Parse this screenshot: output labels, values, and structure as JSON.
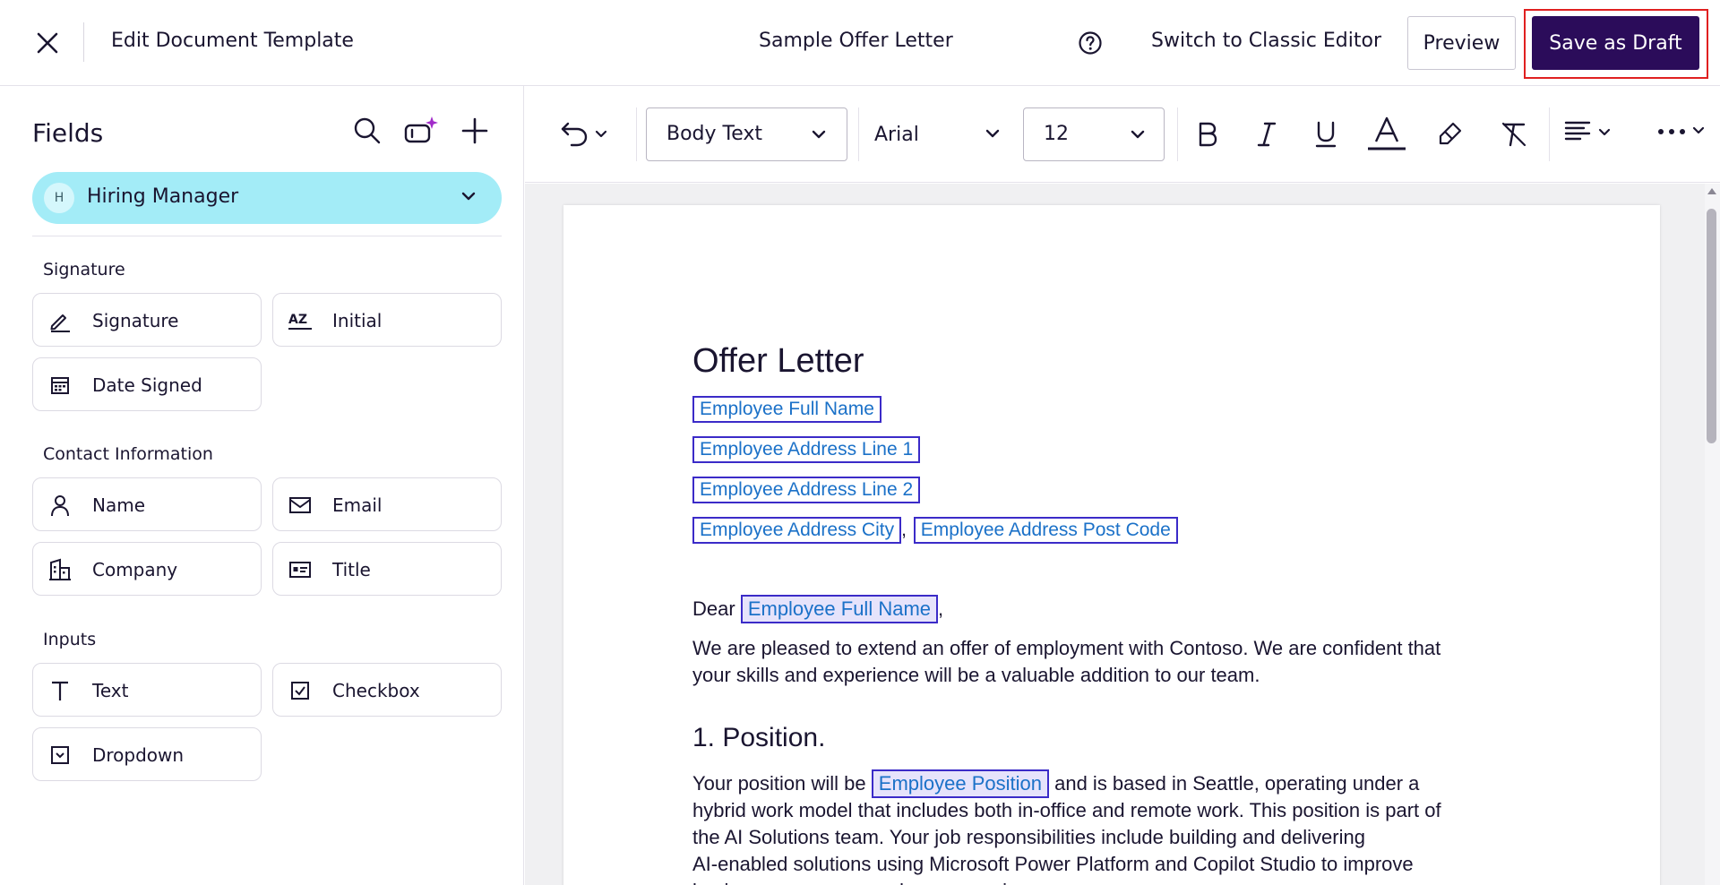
{
  "header": {
    "app_title": "Edit Document Template",
    "document_title": "Sample Offer Letter",
    "classic_editor_label": "Switch to Classic Editor",
    "preview_label": "Preview",
    "save_draft_label": "Save as Draft"
  },
  "sidebar": {
    "title": "Fields",
    "recipient": {
      "initial": "H",
      "name": "Hiring Manager"
    },
    "sections": [
      {
        "label": "Signature",
        "fields": [
          {
            "label": "Signature",
            "icon": "pen-icon"
          },
          {
            "label": "Initial",
            "icon": "initials-icon"
          },
          {
            "label": "Date Signed",
            "icon": "calendar-icon"
          }
        ]
      },
      {
        "label": "Contact Information",
        "fields": [
          {
            "label": "Name",
            "icon": "person-icon"
          },
          {
            "label": "Email",
            "icon": "envelope-icon"
          },
          {
            "label": "Company",
            "icon": "building-icon"
          },
          {
            "label": "Title",
            "icon": "id-card-icon"
          }
        ]
      },
      {
        "label": "Inputs",
        "fields": [
          {
            "label": "Text",
            "icon": "text-icon"
          },
          {
            "label": "Checkbox",
            "icon": "checkbox-icon"
          },
          {
            "label": "Dropdown",
            "icon": "dropdown-icon"
          }
        ]
      }
    ]
  },
  "toolbar": {
    "style": "Body Text",
    "font": "Arial",
    "size": "12"
  },
  "document": {
    "heading": "Offer Letter",
    "fields": {
      "full_name": "Employee Full Name",
      "address_line_1": "Employee Address Line 1",
      "address_line_2": "Employee Address Line 2",
      "address_city": "Employee Address City",
      "address_post_code": "Employee Address Post Code",
      "position": "Employee Position"
    },
    "comma": ",",
    "greeting": "Dear",
    "intro_line_1": "We are pleased to extend an offer of employment with Contoso. We are confident that",
    "intro_line_2": "your skills and experience will be a valuable addition to our team.",
    "section_1_heading": "1. Position.",
    "position_prefix": "Your position will be",
    "position_suffix": "and is based in Seattle, operating under a",
    "position_line_2": "hybrid work model that includes both in-office and remote work. This position is part of",
    "position_line_3": "the AI Solutions team. Your job responsibilities include building and delivering",
    "position_line_4": "AI-enabled solutions using Microsoft Power Platform and Copilot Studio to improve",
    "position_line_5": "business processes and user experiences."
  },
  "colors": {
    "primary": "#2b0c5a",
    "recipient_chip": "#a3ecf7",
    "field_token_border": "#3b2bc8",
    "field_token_text": "#1b71c8",
    "highlight": "#e02020"
  }
}
